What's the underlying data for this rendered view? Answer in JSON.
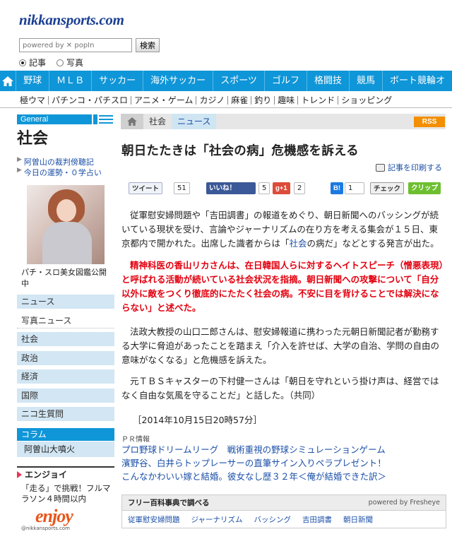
{
  "header": {
    "logo": "nikkansports.com",
    "search": {
      "placeholder": "powered by ✕ popIn",
      "button": "検索"
    },
    "radio": [
      {
        "label": "記事",
        "checked": true
      },
      {
        "label": "写真",
        "checked": false
      }
    ]
  },
  "nav_main": [
    "野球",
    "ＭＬＢ",
    "サッカー",
    "海外サッカー",
    "スポーツ",
    "ゴルフ",
    "格闘技",
    "競馬",
    "ボート競輪オ"
  ],
  "nav_sub": [
    "極ウマ",
    "パチンコ・パチスロ",
    "アニメ・ゲーム",
    "カジノ",
    "麻雀",
    "釣り",
    "趣味",
    "トレンド",
    "ショッピング"
  ],
  "sidebar": {
    "general": "General",
    "section_title": "社会",
    "links": [
      "阿曽山の裁判傍聴記",
      "今日の運勢・０学占い"
    ],
    "photo_caption": "パチ・スロ美女図鑑公開中",
    "menu": [
      "ニュース",
      "写真ニュース",
      "社会",
      "政治",
      "経済",
      "国際",
      "ニコ生質問"
    ],
    "column": "コラム",
    "column_sub": "阿曽山大噴火",
    "enjoy_heading": "エンジョイ",
    "enjoy_text": "「走る」で挑戦！フルマラソン４時間以内",
    "enjoy_logo": "enjoy",
    "enjoy_logo_sub": "@nikkansports.com"
  },
  "breadcrumb": [
    "社会",
    "ニュース"
  ],
  "rss": "RSS",
  "article": {
    "headline": "朝日たたきは「社会の病」危機感を訴える",
    "print": "記事を印刷する",
    "share": {
      "tweet": "ツイート",
      "tweet_count": "51",
      "like": "いいね！",
      "like_count": "5",
      "gplus": "g+1",
      "gplus_count": "2",
      "hatena": "B!",
      "hatena_count": "1",
      "check": "チェック",
      "clip": "クリップ"
    },
    "p1_a": "従軍慰安婦問題や「吉田調書」の報道をめぐり、朝日新聞へのバッシングが続いている現状を受け、言論やジャーナリズムの在り方を考える集会が１５日、東京都内で開かれた。出席した識者からは「",
    "p1_kw": "社会",
    "p1_b": "の病だ」などとする発言が出た。",
    "p2": "精神科医の香山リカさんは、在日韓国人らに対するヘイトスピーチ（憎悪表現）と呼ばれる活動が続いている社会状況を指摘。朝日新聞への攻撃について「自分以外に敵をつくり徹底的にたたく社会の病。不安に目を背けることでは解決にならない」と述べた。",
    "p3": "法政大教授の山口二郎さんは、慰安婦報道に携わった元朝日新聞記者が勤務する大学に脅迫があったことを踏まえ「介入を許せば、大学の自治、学問の自由の意味がなくなる」と危機感を訴えた。",
    "p4": "元ＴＢＳキャスターの下村健一さんは「朝日を守れという掛け声は、経営ではなく自由な気風を守ることだ」と話した。（共同）",
    "date": "［2014年10月15日20時57分］"
  },
  "pr": {
    "heading": "ＰＲ情報",
    "links": [
      "プロ野球ドリームリーグ　戦術重視の野球シミュレーションゲーム",
      "濱野谷、白井らトップレーサーの直筆サイン入りペラプレゼント！",
      "こんなかわいい嫁と結婚。彼女なし歴３２年＜俺が結婚できた訳＞"
    ]
  },
  "dictionary": {
    "heading": "フリー百科事典で調べる",
    "powered": "powered by Fresheye",
    "keywords": [
      "従軍慰安婦問題",
      "ジャーナリズム",
      "バッシング",
      "吉田調書",
      "朝日新聞"
    ]
  },
  "colors": {
    "brand": "#1b3f93",
    "nav": "#0f96d8",
    "red_text": "#e3000f",
    "link": "#1a4fa8"
  }
}
